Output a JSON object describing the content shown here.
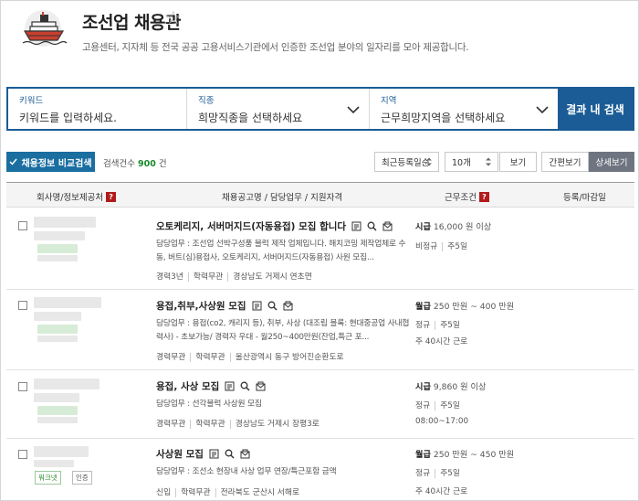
{
  "header": {
    "title": "조선업 채용관",
    "subtitle": "고용센터, 지자체 등 전국 공공 고용서비스기관에서 인증한 조선업 분야의 일자리를 모아 제공합니다."
  },
  "search": {
    "keyword_label": "키워드",
    "keyword_placeholder": "키워드를 입력하세요.",
    "job_label": "직종",
    "job_value": "희망직종을 선택하세요",
    "region_label": "지역",
    "region_value": "근무희망지역을 선택하세요",
    "button": "결과 내 검색"
  },
  "toolbar": {
    "compare_button": "채용정보 비교검색",
    "count_label": "검색건수",
    "count_value": "900",
    "count_unit": "건",
    "sort_value": "최근등록일순",
    "page_size_value": "10개",
    "view_button": "보기",
    "simple_view": "간편보기",
    "detail_view": "상세보기"
  },
  "table": {
    "headers": {
      "company": "회사명/정보제공처",
      "posting": "채용공고명 / 담당업무 / 지원자격",
      "condition": "근무조건",
      "date": "등록/마감일"
    },
    "rows": [
      {
        "title": "오토케리지, 서버머지드(자동용접) 모집 합니다",
        "duty": "담당업무 : 조선업 선박구성품 블럭 제작 업체입니다. 해치코밍 제작업체로 수동, 버트(심)용접사, 오토케리지, 서버머지드(자동용접) 사원 모집...",
        "meta": [
          "경력3년",
          "학력무관",
          "경상남도 거제시 연초면"
        ],
        "pay_type": "시급",
        "pay_value": "16,000 원 이상",
        "conditions": [
          "비정규",
          "주5일"
        ],
        "hours": ""
      },
      {
        "title": "용접,취부,사상원 모집",
        "duty": "담당업무 : 용접(co2, 캐리지 등), 취부, 사상 (대조립 블록: 현대중공업 사내협력사) - 초보가능/ 경력자 우대 - 월250~400만원(잔업,특근 포...",
        "meta": [
          "경력무관",
          "학력무관",
          "울산광역시 동구 방어진순환도로"
        ],
        "pay_type": "월급",
        "pay_value": "250 만원 ~ 400 만원",
        "conditions": [
          "정규",
          "주5일"
        ],
        "hours": "주 40시간 근로"
      },
      {
        "title": "용접, 사상 모집",
        "duty": "담당업무 : 선각블럭 사상원 모집",
        "meta": [
          "경력무관",
          "학력무관",
          "경상남도 거제시 장평3로"
        ],
        "pay_type": "시급",
        "pay_value": "9,860 원 이상",
        "conditions": [
          "정규",
          "주5일"
        ],
        "hours": "08:00~17:00"
      },
      {
        "title": "사상원 모집",
        "duty": "담당업무 : 조선소 현장내 사상 업무 연장/특근포함 금액",
        "meta": [
          "신입",
          "학력무관",
          "전라북도 군산시 서해로"
        ],
        "pay_type": "월급",
        "pay_value": "250 만원 ~ 450 만원",
        "conditions": [
          "정규",
          "주5일"
        ],
        "hours": "주 40시간 근로",
        "tags": [
          "워크넷",
          "인증"
        ]
      }
    ]
  }
}
